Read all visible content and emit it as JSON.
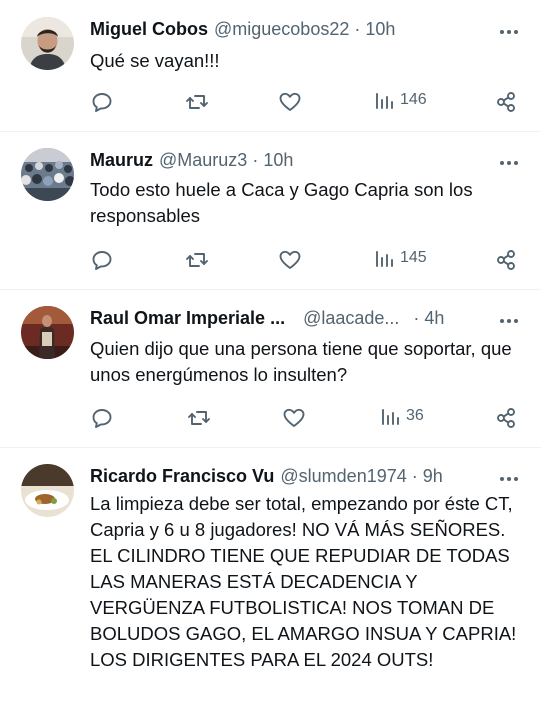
{
  "tweets": [
    {
      "name": "Miguel Cobos",
      "handle": "@miguecobos22",
      "separator": "·",
      "time": "10h",
      "text": "Qué se vayan!!!",
      "views": "146",
      "avatar_icon": "person-avatar-icon"
    },
    {
      "name": "Mauruz",
      "handle": "@Mauruz3",
      "separator": "·",
      "time": "10h",
      "text": "Todo esto huele a Caca y Gago Capria son los responsables",
      "views": "145",
      "avatar_icon": "crowd-avatar-icon"
    },
    {
      "name": "Raul Omar Imperiale ...",
      "handle": "@laacade...",
      "separator": "·",
      "time": "4h",
      "text": "Quien dijo que una persona tiene que soportar, que unos energúmenos lo insulten?",
      "views": "36",
      "avatar_icon": "person-avatar-icon"
    },
    {
      "name": "Ricardo Francisco Vu",
      "handle": "@slumden1974",
      "separator": "·",
      "time": "9h",
      "text": "La limpieza debe ser total, empezando por éste CT, Capria y 6 u 8 jugadores! NO VÁ MÁS SEÑORES. EL CILINDRO TIENE QUE REPUDIAR DE TODAS LAS MANERAS ESTÁ DECADENCIA Y VERGÜENZA FUTBOLISTICA! NOS TOMAN DE BOLUDOS GAGO, EL AMARGO INSUA Y CAPRIA! LOS DIRIGENTES PARA EL 2024 OUTS!",
      "avatar_icon": "food-avatar-icon"
    }
  ],
  "colors": {
    "text": "#0f1419",
    "secondary": "#536471",
    "separator": "#eff3f4"
  }
}
